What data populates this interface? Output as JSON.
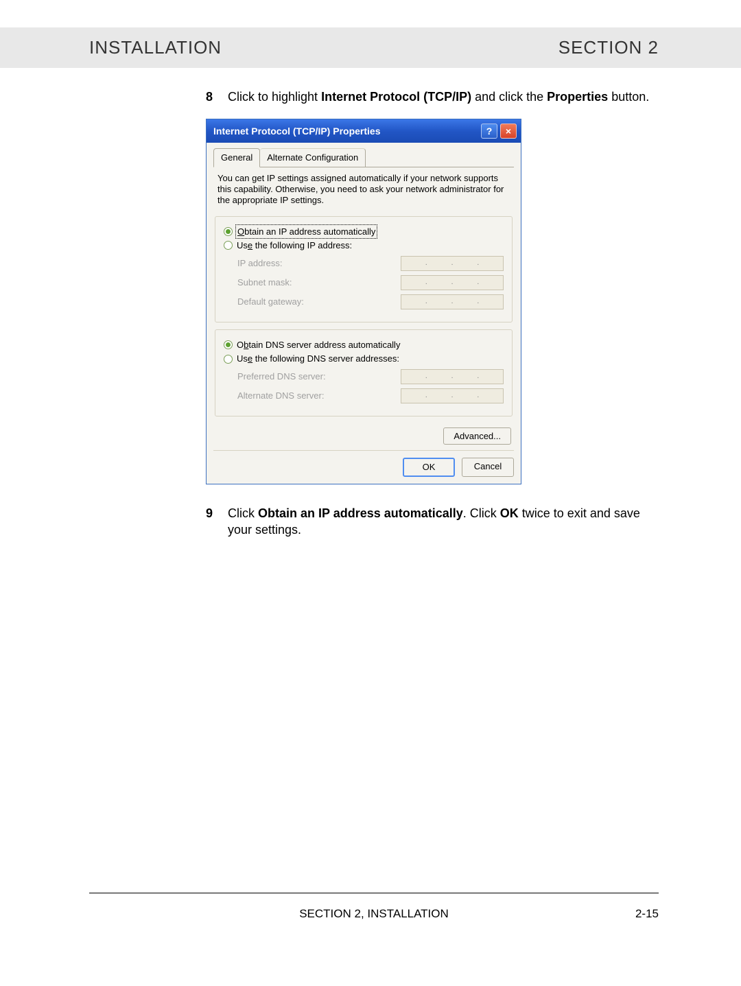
{
  "header": {
    "left": "INSTALLATION",
    "right": "SECTION 2"
  },
  "steps": {
    "s8": {
      "num": "8",
      "pre": "Click to highlight ",
      "b1": "Internet Protocol (TCP/IP)",
      "mid": " and click the ",
      "b2": "Properties",
      "post": " button."
    },
    "s9": {
      "num": "9",
      "pre": "Click ",
      "b1": "Obtain an IP address automatically",
      "mid": ". Click ",
      "b2": "OK",
      "post": " twice to exit and save your settings."
    }
  },
  "dialog": {
    "title": "Internet Protocol (TCP/IP) Properties",
    "tabs": {
      "general": "General",
      "alt": "Alternate Configuration"
    },
    "intro": "You can get IP settings assigned automatically if your network supports this capability. Otherwise, you need to ask your network administrator for the appropriate IP settings.",
    "radio_obtain_ip_pre": "O",
    "radio_obtain_ip": "btain an IP address automatically",
    "radio_use_ip_pre": "Us",
    "radio_use_ip_u": "e",
    "radio_use_ip_post": " the following IP address:",
    "ip_address": "IP address:",
    "subnet": "Subnet mask:",
    "gateway": "Default gateway:",
    "radio_obtain_dns_pre": "O",
    "radio_obtain_dns_u": "b",
    "radio_obtain_dns_post": "tain DNS server address automatically",
    "radio_use_dns_pre": "Us",
    "radio_use_dns_u": "e",
    "radio_use_dns_post": " the following DNS server addresses:",
    "pref_dns": "Preferred DNS server:",
    "alt_dns": "Alternate DNS server:",
    "advanced": "Advanced...",
    "ok": "OK",
    "cancel": "Cancel"
  },
  "footer": {
    "text": "SECTION 2, INSTALLATION",
    "page": "2-15"
  }
}
